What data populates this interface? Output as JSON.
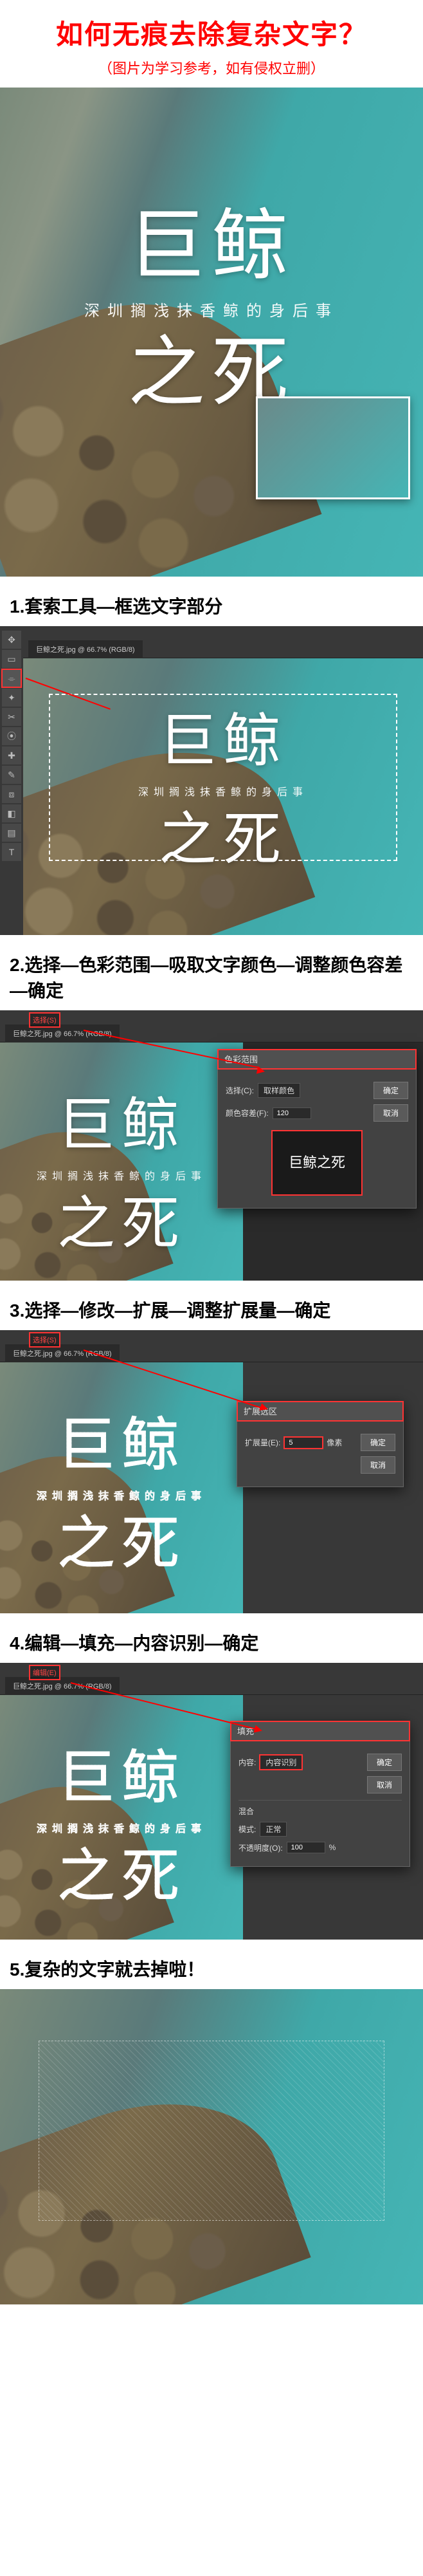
{
  "header": {
    "title": "如何无痕去除复杂文字？",
    "subtitle": "（图片为学习参考，如有侵权立删）"
  },
  "sample": {
    "line1": "巨鲸",
    "sub": "深圳搁浅抹香鲸的身后事",
    "line2": "之死"
  },
  "steps": {
    "s1": "1.套索工具—框选文字部分",
    "s2": "2.选择—色彩范围—吸取文字颜色—调整颜色容差—确定",
    "s3": "3.选择—修改—扩展—调整扩展量—确定",
    "s4": "4.编辑—填充—内容识别—确定",
    "s5": "5.复杂的文字就去掉啦！"
  },
  "ps": {
    "tab": "巨鲸之死.jpg @ 66.7% (RGB/8)",
    "menu_select": "选择(S)",
    "menu_edit": "编辑(E)"
  },
  "dialogs": {
    "color_range": {
      "title": "色彩范围",
      "label_select": "选择(C):",
      "opt_sampled": "取样颜色",
      "label_fuzz": "颜色容差(F):",
      "fuzz_value": "120",
      "ok": "确定",
      "cancel": "取消",
      "preview_text": "巨鲸之死"
    },
    "expand": {
      "title": "扩展选区",
      "label": "扩展量(E):",
      "value": "5",
      "unit": "像素",
      "ok": "确定",
      "cancel": "取消"
    },
    "fill": {
      "title": "填充",
      "label_content": "内容:",
      "opt_content_aware": "内容识别",
      "label_blend": "混合",
      "label_mode": "模式:",
      "mode_normal": "正常",
      "label_opacity": "不透明度(O):",
      "opacity": "100",
      "pct": "%",
      "ok": "确定",
      "cancel": "取消"
    }
  }
}
